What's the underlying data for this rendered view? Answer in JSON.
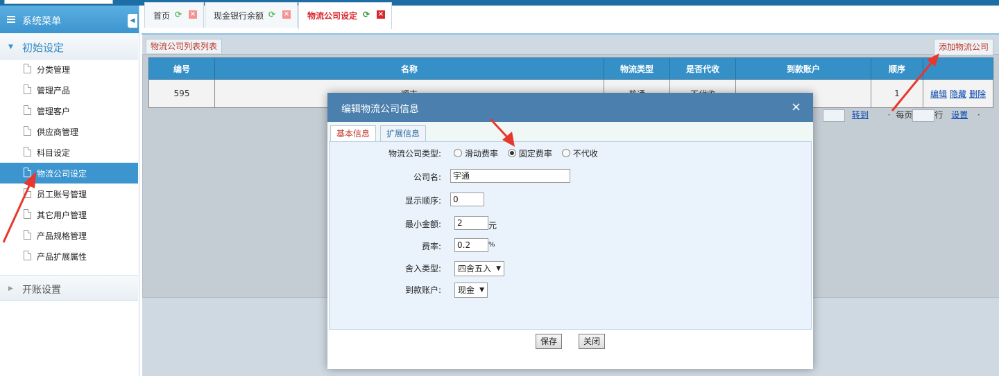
{
  "sidebar": {
    "header": "系统菜单",
    "groups": [
      {
        "label": "初始设定"
      },
      {
        "label": "开账设置"
      }
    ],
    "items": [
      {
        "label": "分类管理"
      },
      {
        "label": "管理产品"
      },
      {
        "label": "管理客户"
      },
      {
        "label": "供应商管理"
      },
      {
        "label": "科目设定"
      },
      {
        "label": "物流公司设定"
      },
      {
        "label": "员工账号管理"
      },
      {
        "label": "其它用户管理"
      },
      {
        "label": "产品规格管理"
      },
      {
        "label": "产品扩展属性"
      }
    ],
    "active_index": 5
  },
  "tabs": [
    {
      "label": "首页"
    },
    {
      "label": "现金银行余额"
    },
    {
      "label": "物流公司设定"
    }
  ],
  "list": {
    "tab_label": "物流公司列表列表",
    "add_label": "添加物流公司",
    "columns": [
      "编号",
      "名称",
      "物流类型",
      "是否代收",
      "到款账户",
      "顺序"
    ],
    "rows": [
      {
        "id": "595",
        "name": "顺丰",
        "type": "普通",
        "cod": "不代收",
        "account": "",
        "order": "1",
        "actions": [
          "编辑",
          "隐藏",
          "删除"
        ]
      }
    ]
  },
  "pager": {
    "goto_label": "转到",
    "per_page_label": "每页",
    "row_label": "行",
    "settings_label": "设置",
    "dot": "·"
  },
  "modal": {
    "title": "编辑物流公司信息",
    "close_glyph": "×",
    "tabs": [
      "基本信息",
      "扩展信息"
    ],
    "fields": {
      "type_label": "物流公司类型:",
      "type_options": [
        "滑动费率",
        "固定费率",
        "不代收"
      ],
      "type_selected": 1,
      "name_label": "公司名:",
      "name_value": "宇通",
      "order_label": "显示顺序:",
      "order_value": "0",
      "min_label": "最小金额:",
      "min_value": "2",
      "min_unit": "元",
      "rate_label": "费率:",
      "rate_value": "0.2",
      "rate_unit": "%",
      "round_label": "舍入类型:",
      "round_value": "四舍五入",
      "account_label": "到款账户:",
      "account_value": "现金"
    },
    "save_label": "保存",
    "close_label": "关闭"
  },
  "colors": {
    "accent": "#3d95cf",
    "active_tab": "#d9272e",
    "annotation_arrow": "#e8372c"
  }
}
